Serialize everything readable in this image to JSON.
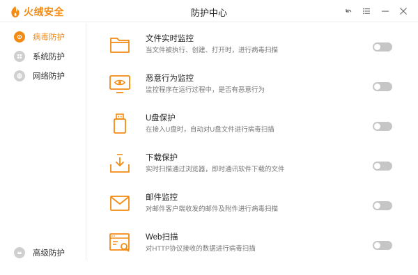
{
  "app": {
    "name": "火绒安全",
    "window_title": "防护中心",
    "accent_color": "#f48a12"
  },
  "window_controls": [
    {
      "name": "back-icon",
      "glyph": "↶"
    },
    {
      "name": "menu-icon",
      "glyph": "☰"
    },
    {
      "name": "minimize-icon",
      "glyph": "—"
    },
    {
      "name": "close-icon",
      "glyph": "✕"
    }
  ],
  "sidebar": {
    "items": [
      {
        "label": "病毒防护",
        "active": true,
        "icon": "virus-shield-icon"
      },
      {
        "label": "系统防护",
        "active": false,
        "icon": "system-shield-icon"
      },
      {
        "label": "网络防护",
        "active": false,
        "icon": "network-shield-icon"
      }
    ],
    "bottom_item": {
      "label": "高级防护",
      "icon": "advanced-shield-icon"
    }
  },
  "features": [
    {
      "title": "文件实时监控",
      "desc": "当文件被执行、创建、打开时，进行病毒扫描",
      "icon": "folder-icon",
      "enabled": false
    },
    {
      "title": "恶意行为监控",
      "desc": "监控程序在运行过程中，是否有恶意行为",
      "icon": "monitor-eye-icon",
      "enabled": false
    },
    {
      "title": "U盘保护",
      "desc": "在接入U盘时，自动对U盘文件进行病毒扫描",
      "icon": "usb-drive-icon",
      "enabled": false
    },
    {
      "title": "下载保护",
      "desc": "实时扫描通过浏览器，即时通讯软件下载的文件",
      "icon": "download-tray-icon",
      "enabled": false
    },
    {
      "title": "邮件监控",
      "desc": "对邮件客户端收发的邮件及附件进行病毒扫描",
      "icon": "mail-icon",
      "enabled": false
    },
    {
      "title": "Web扫描",
      "desc": "对HTTP协议接收的数据进行病毒扫描",
      "icon": "web-scan-icon",
      "enabled": false
    }
  ]
}
